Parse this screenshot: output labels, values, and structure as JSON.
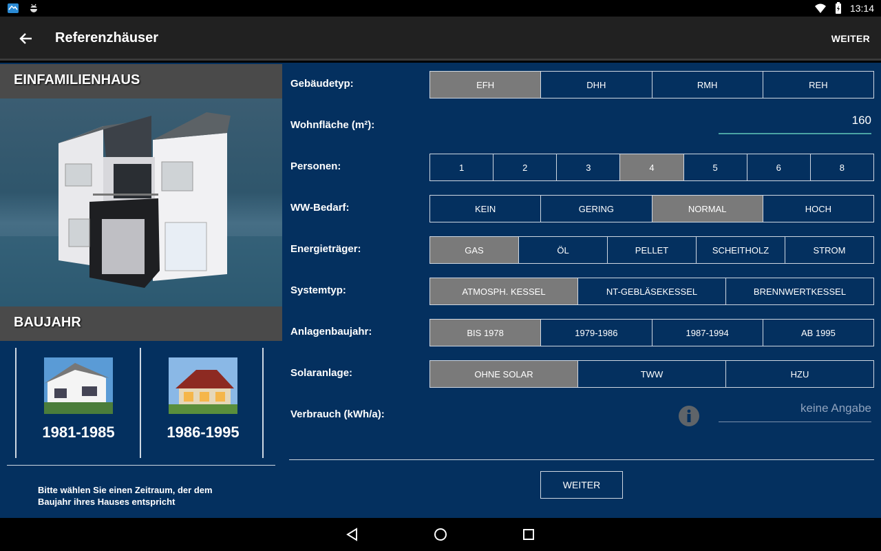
{
  "status": {
    "time": "13:14"
  },
  "appbar": {
    "title": "Referenzhäuser",
    "action": "WEITER"
  },
  "left": {
    "house_header": "EINFAMILIENHAUS",
    "baujahr_header": "BAUJAHR",
    "years": [
      "1981-1985",
      "1986-1995"
    ],
    "hint": "Bitte wählen Sie einen Zeitraum, der dem Baujahr ihres Hauses entspricht"
  },
  "form": {
    "gebaeudetyp": {
      "label": "Gebäudetyp:",
      "options": [
        "EFH",
        "DHH",
        "RMH",
        "REH"
      ],
      "selected": 0
    },
    "wohnflaeche": {
      "label": "Wohnfläche (m²):",
      "value": "160"
    },
    "personen": {
      "label": "Personen:",
      "options": [
        "1",
        "2",
        "3",
        "4",
        "5",
        "6",
        "8"
      ],
      "selected": 3
    },
    "ww_bedarf": {
      "label": "WW-Bedarf:",
      "options": [
        "KEIN",
        "GERING",
        "NORMAL",
        "HOCH"
      ],
      "selected": 2
    },
    "energietraeger": {
      "label": "Energieträger:",
      "options": [
        "GAS",
        "ÖL",
        "PELLET",
        "SCHEITHOLZ",
        "STROM"
      ],
      "selected": 0
    },
    "systemtyp": {
      "label": "Systemtyp:",
      "options": [
        "ATMOSPH. KESSEL",
        "NT-GEBLÄSEKESSEL",
        "BRENNWERTKESSEL"
      ],
      "selected": 0
    },
    "anlagenbaujahr": {
      "label": "Anlagenbaujahr:",
      "options": [
        "BIS 1978",
        "1979-1986",
        "1987-1994",
        "AB 1995"
      ],
      "selected": 0
    },
    "solaranlage": {
      "label": "Solaranlage:",
      "options": [
        "OHNE SOLAR",
        "TWW",
        "HZU"
      ],
      "selected": 0
    },
    "verbrauch": {
      "label": "Verbrauch (kWh/a):",
      "placeholder": "keine Angabe"
    }
  },
  "weiter_button": "WEITER",
  "colors": {
    "background": "#04305f",
    "selected": "#7a7a7a",
    "appbar": "#212121"
  }
}
